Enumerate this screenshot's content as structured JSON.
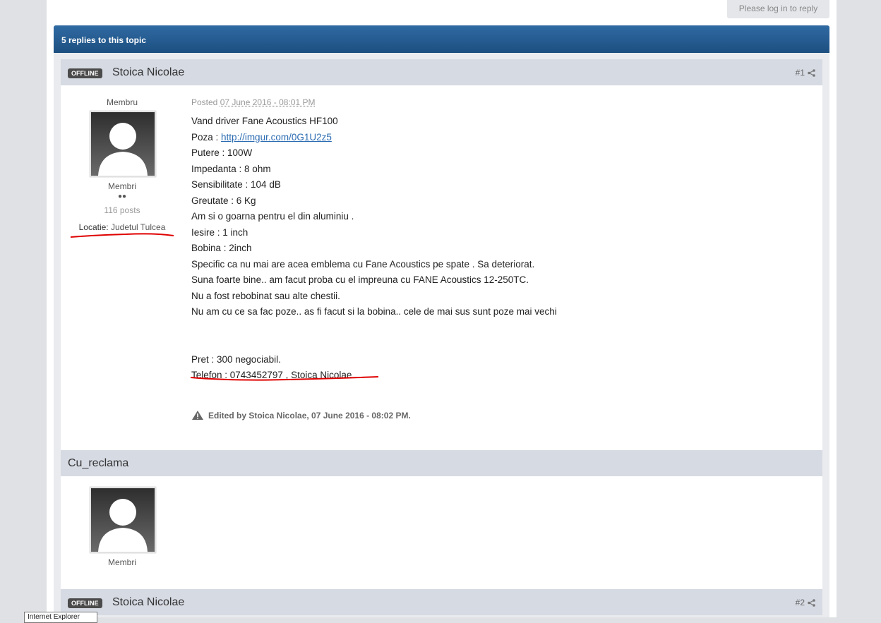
{
  "header": {
    "reply_button": "Please log in to reply",
    "topic_bar": "5 replies to this topic"
  },
  "post1": {
    "badge": "OFFLINE",
    "author": "Stoica Nicolae",
    "number": "#1",
    "group_top": "Membru",
    "group": "Membri",
    "posts": "116 posts",
    "location_label": "Locatie:",
    "location_value": "Judetul Tulcea",
    "posted_label": "Posted",
    "posted_date": "07 June 2016 - 08:01 PM",
    "lines": [
      "Vand driver Fane Acoustics HF100",
      "Poza :",
      "Putere : 100W",
      "Impedanta : 8 ohm",
      "Sensibilitate : 104 dB",
      "Greutate : 6 Kg",
      "Am si o goarna pentru el din aluminiu .",
      "Iesire : 1 inch",
      "Bobina : 2inch",
      "Specific ca nu mai are acea emblema cu Fane Acoustics pe spate . Sa deteriorat.",
      "Suna foarte bine.. am facut proba cu el impreuna cu FANE Acoustics 12-250TC.",
      "Nu a fost rebobinat sau alte chestii.",
      "Nu am cu ce sa fac poze.. as fi facut si la bobina.. cele de mai sus sunt poze mai vechi",
      "",
      "",
      "Pret : 300 negociabil.",
      "Telefon : 0743452797 , Stoica Nicolae"
    ],
    "link": "http://imgur.com/0G1U2z5",
    "edited": "Edited by Stoica Nicolae, 07 June 2016 - 08:02 PM."
  },
  "ad": {
    "author": "Cu_reclama",
    "group": "Membri"
  },
  "post2": {
    "badge": "OFFLINE",
    "author": "Stoica Nicolae",
    "number": "#2"
  },
  "taskbar": {
    "tab": "Internet Explorer"
  },
  "colors": {
    "topic_bar": "#1d4f80",
    "link": "#2a6bb1",
    "annotation": "#e00000"
  }
}
